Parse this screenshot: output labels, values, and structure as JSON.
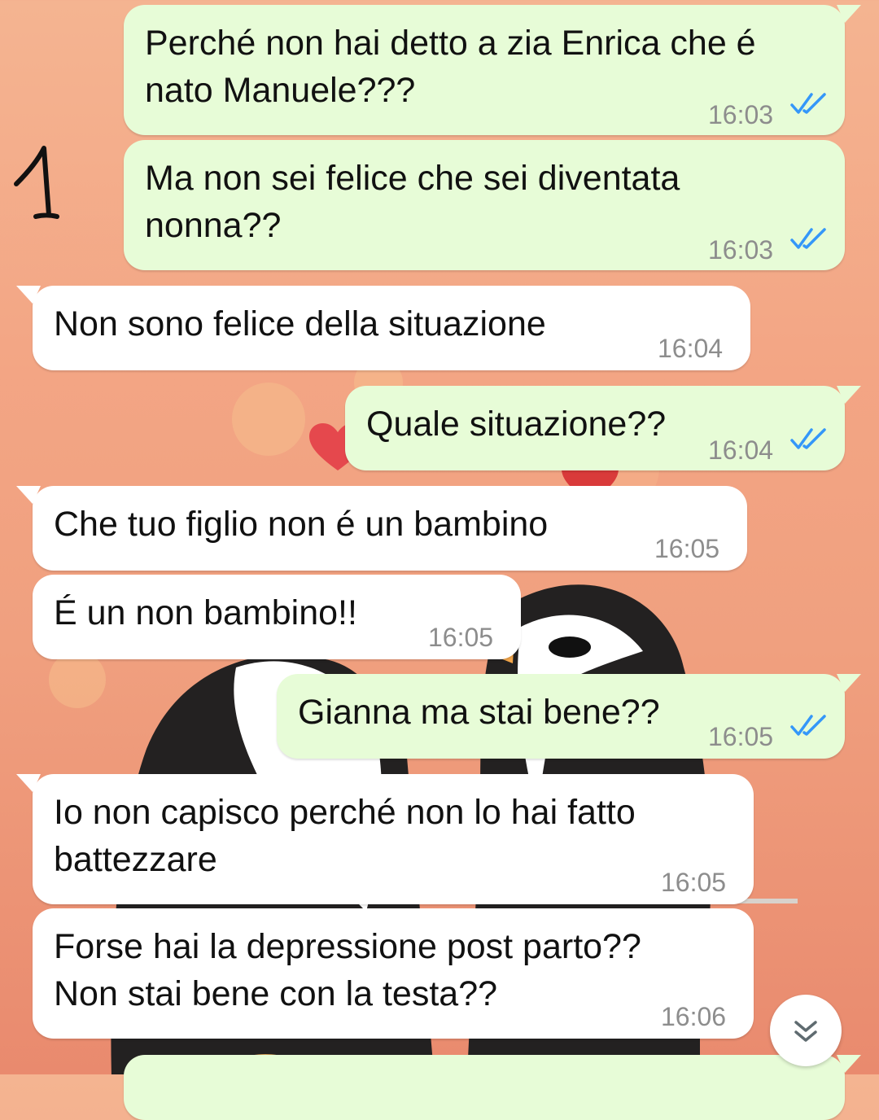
{
  "annotation": "1",
  "messages": [
    {
      "text": "Perché non hai detto a zia Enrica che é\nnato Manuele???",
      "time": "16:03"
    },
    {
      "text": "Ma non sei felice che sei diventata\nnonna??",
      "time": "16:03"
    },
    {
      "text": "Non sono felice della situazione",
      "time": "16:04"
    },
    {
      "text": "Quale situazione??",
      "time": "16:04"
    },
    {
      "text": "Che tuo figlio non é un bambino",
      "time": "16:05"
    },
    {
      "text": "É un non bambino!!",
      "time": "16:05"
    },
    {
      "text": "Gianna ma stai bene??",
      "time": "16:05"
    },
    {
      "text": "Io non capisco perché non lo hai fatto\nbattezzare",
      "time": "16:05"
    },
    {
      "text": "Forse hai la depressione post parto??\nNon stai bene con la testa??",
      "time": "16:06"
    }
  ],
  "colors": {
    "outgoing_bubble": "#e7fcd7",
    "incoming_bubble": "#ffffff",
    "read_ticks": "#3497f9"
  },
  "icons": {
    "read_receipt": "double-check-icon",
    "scroll_down": "chevron-double-down-icon"
  }
}
